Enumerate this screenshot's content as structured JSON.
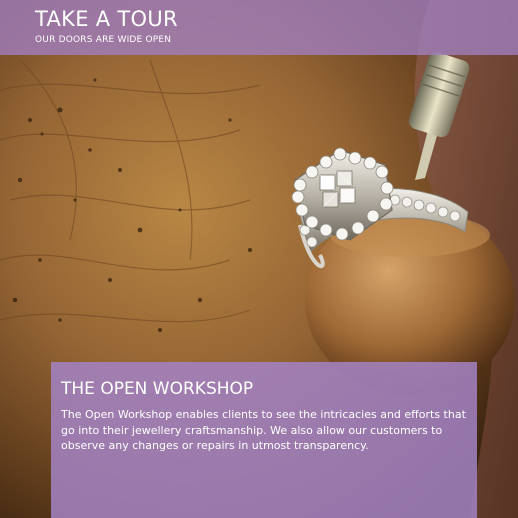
{
  "header": {
    "title": "TAKE A TOUR",
    "subtitle": "OUR DOORS ARE WIDE OPEN"
  },
  "panel": {
    "title": "THE OPEN WORKSHOP",
    "body": "The Open Workshop enables clients to see the intricacies and efforts that go into their jewellery craftsmanship. We also allow our customers to observe any changes or repairs in utmost transparency."
  },
  "colors": {
    "overlay_purple": "#a07ebe",
    "text": "#ffffff",
    "wood": "#8b5e2c"
  },
  "image": {
    "subject": "ring-on-mandrel-with-engraving-tool"
  }
}
